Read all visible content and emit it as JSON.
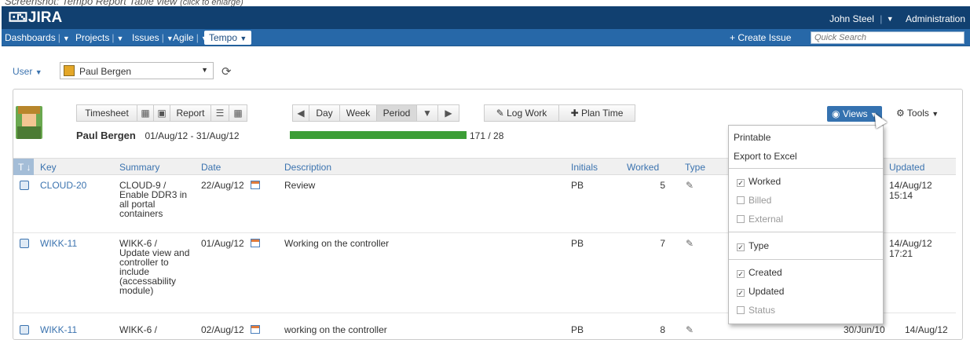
{
  "caption": {
    "main": "Screenshot: Tempo Report Table view",
    "small": "(click to enlarge)"
  },
  "header": {
    "logo": "JIRA",
    "user": "John Steel",
    "admin": "Administration"
  },
  "nav": {
    "items": [
      "Dashboards",
      "Projects",
      "Issues",
      "Agile"
    ],
    "active": "Tempo",
    "create": "+ Create Issue",
    "search_placeholder": "Quick Search"
  },
  "user_selector": {
    "label": "User",
    "value": "Paul Bergen"
  },
  "toolbar": {
    "timesheet": "Timesheet",
    "report": "Report",
    "day": "Day",
    "week": "Week",
    "period": "Period",
    "log_work": "Log Work",
    "plan_time": "Plan Time",
    "views": "Views",
    "tools": "Tools"
  },
  "summary": {
    "name": "Paul Bergen",
    "period": "01/Aug/12 - 31/Aug/12",
    "progress_text": "171 / 28",
    "progress_fraction": 1.0,
    "progress_color": "#3c9e36"
  },
  "table": {
    "headers": {
      "type": "T",
      "key": "Key",
      "summary": "Summary",
      "date": "Date",
      "description": "Description",
      "initials": "Initials",
      "worked": "Worked",
      "type_col": "Type",
      "updated": "Updated"
    },
    "rows": [
      {
        "key": "CLOUD-20",
        "summary": "CLOUD-9 / Enable DDR3 in all portal containers",
        "date": "22/Aug/12",
        "description": "Review",
        "initials": "PB",
        "worked": "5",
        "updated": "14/Aug/12 15:14"
      },
      {
        "key": "WIKK-11",
        "summary": "WIKK-6 / Update view and controller to include (accessability module)",
        "date": "01/Aug/12",
        "description": "Working on the controller",
        "initials": "PB",
        "worked": "7",
        "updated": "14/Aug/12 17:21"
      },
      {
        "key": "WIKK-11",
        "summary": "WIKK-6 /",
        "date": "02/Aug/12",
        "description": "working on the controller",
        "initials": "PB",
        "worked": "8",
        "created": "30/Jun/10",
        "updated": "14/Aug/12"
      }
    ]
  },
  "views_menu": {
    "actions": [
      "Printable",
      "Export to Excel"
    ],
    "groups": [
      [
        {
          "label": "Worked",
          "checked": true
        },
        {
          "label": "Billed",
          "checked": false
        },
        {
          "label": "External",
          "checked": false
        }
      ],
      [
        {
          "label": "Type",
          "checked": true
        }
      ],
      [
        {
          "label": "Created",
          "checked": true
        },
        {
          "label": "Updated",
          "checked": true
        },
        {
          "label": "Status",
          "checked": false
        }
      ]
    ]
  }
}
